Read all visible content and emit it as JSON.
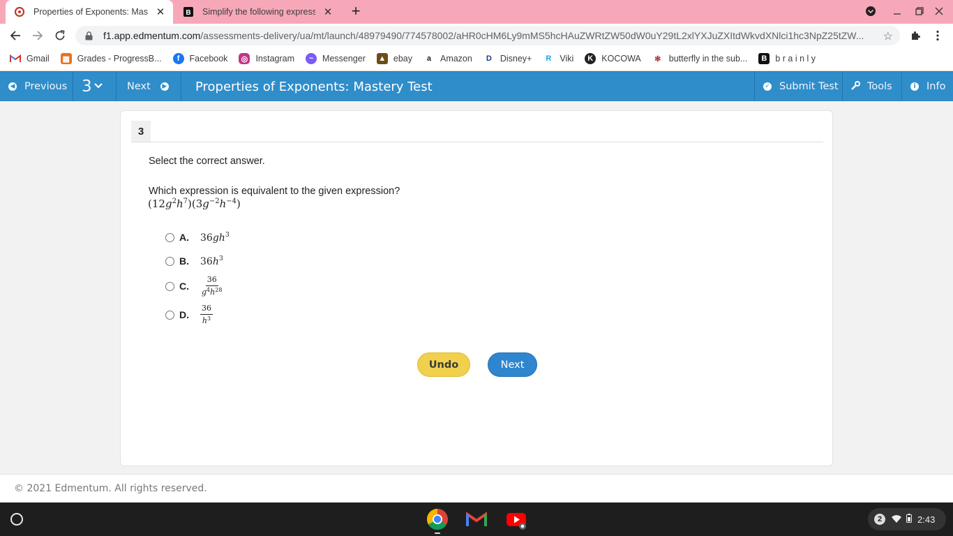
{
  "browser": {
    "tabs": [
      {
        "title": "Properties of Exponents: Mastery Test",
        "favicon": "edmentum-icon",
        "active": true
      },
      {
        "title": "Simplify the following expression",
        "favicon": "brainly-icon",
        "active": false
      }
    ],
    "url_host": "f1.app.edmentum.com",
    "url_path": "/assessments-delivery/ua/mt/launch/48979490/774578002/aHR0cHM6Ly9mMS5hcHAuZWRtZW50dW0uY29tL2xlYXJuZXItdWkvdXNlci1hc3NpZ25tZW...",
    "bookmarks": [
      {
        "label": "Gmail",
        "icon": "gmail-icon",
        "color": "#d93025"
      },
      {
        "label": "Grades - ProgressB...",
        "icon": "grades-icon",
        "color": "#e8711c"
      },
      {
        "label": "Facebook",
        "icon": "facebook-icon",
        "color": "#1877f2"
      },
      {
        "label": "Instagram",
        "icon": "instagram-icon",
        "color": "#c13584"
      },
      {
        "label": "Messenger",
        "icon": "messenger-icon",
        "color": "#7a5af8"
      },
      {
        "label": "ebay",
        "icon": "ebay-icon",
        "color": "#6b4e16"
      },
      {
        "label": "Amazon",
        "icon": "amazon-icon",
        "color": "#222222"
      },
      {
        "label": "Disney+",
        "icon": "disney-icon",
        "color": "#1a3a8a"
      },
      {
        "label": "Viki",
        "icon": "viki-icon",
        "color": "#1aa3e8"
      },
      {
        "label": "KOCOWA",
        "icon": "kocowa-icon",
        "color": "#222222"
      },
      {
        "label": "butterfly in the sub...",
        "icon": "butterfly-icon",
        "color": "#b02a2a"
      },
      {
        "label": "b r a i n l y",
        "icon": "brainly-icon",
        "color": "#111111"
      }
    ]
  },
  "appbar": {
    "previous_label": "Previous",
    "question_selector": "3",
    "next_label": "Next",
    "title": "Properties of Exponents: Mastery Test",
    "submit_label": "Submit Test",
    "tools_label": "Tools",
    "info_label": "Info",
    "bar_color": "#2f8dca"
  },
  "question": {
    "number": "3",
    "instruction": "Select the correct answer.",
    "prompt": "Which expression is equivalent to the given expression?",
    "expression": "(12g^2h^7)(3g^-2h^-4)",
    "options": [
      {
        "letter": "A.",
        "text": "36gh^3"
      },
      {
        "letter": "B.",
        "text": "36h^3"
      },
      {
        "letter": "C.",
        "text": "36 / (g^4 h^28)"
      },
      {
        "letter": "D.",
        "text": "36 / h^3"
      }
    ],
    "undo_label": "Undo",
    "next_label": "Next"
  },
  "footer": {
    "copyright": "© 2021 Edmentum. All rights reserved."
  },
  "shelf": {
    "notification_count": "2",
    "time": "2:43"
  }
}
